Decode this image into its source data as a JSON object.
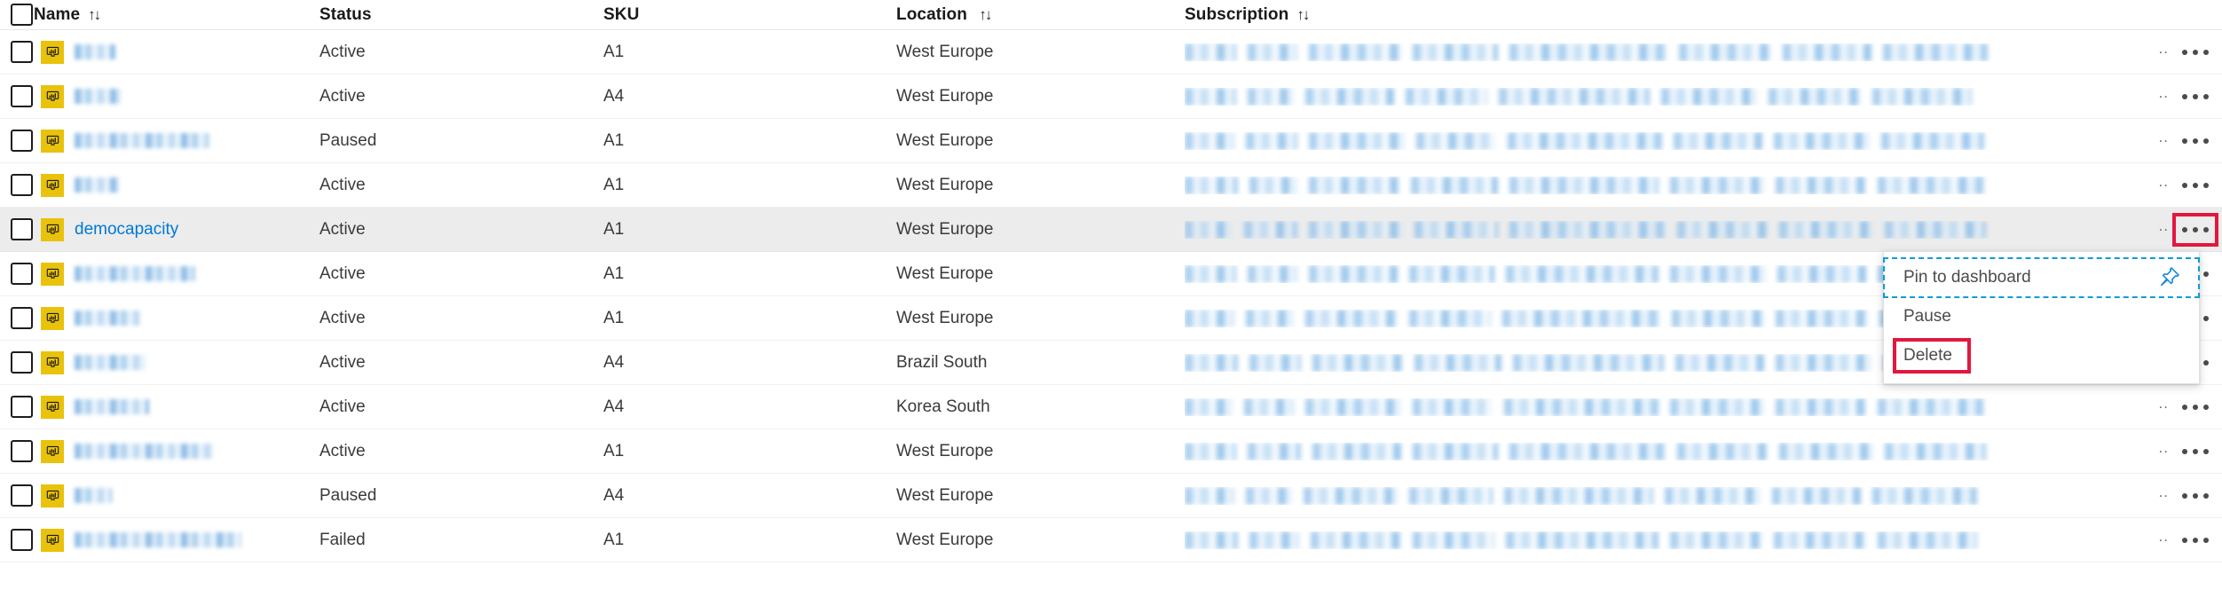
{
  "table": {
    "columns": [
      {
        "key": "name",
        "label": "Name",
        "sortable": true,
        "sort_glyph": "↑↓"
      },
      {
        "key": "status",
        "label": "Status",
        "sortable": false,
        "sort_glyph": ""
      },
      {
        "key": "sku",
        "label": "SKU",
        "sortable": false,
        "sort_glyph": ""
      },
      {
        "key": "location",
        "label": "Location",
        "sortable": true,
        "sort_glyph": "↑↓"
      },
      {
        "key": "subscription",
        "label": "Subscription",
        "sortable": true,
        "sort_glyph": "↑↓"
      }
    ],
    "select_all_checked": false,
    "row_icon": "power-bi-capacity-icon",
    "overflow_label": "…",
    "subscription_truncation": "..",
    "rows": [
      {
        "name": "",
        "redacted_name": true,
        "name_width": 46,
        "status": "Active",
        "sku": "A1",
        "location": "West Europe",
        "selected": false
      },
      {
        "name": "",
        "redacted_name": true,
        "name_width": 52,
        "status": "Active",
        "sku": "A4",
        "location": "West Europe",
        "selected": false
      },
      {
        "name": "",
        "redacted_name": true,
        "name_width": 152,
        "status": "Paused",
        "sku": "A1",
        "location": "West Europe",
        "selected": false
      },
      {
        "name": "",
        "redacted_name": true,
        "name_width": 50,
        "status": "Active",
        "sku": "A1",
        "location": "West Europe",
        "selected": false
      },
      {
        "name": "democapacity",
        "redacted_name": false,
        "name_width": 0,
        "status": "Active",
        "sku": "A1",
        "location": "West Europe",
        "selected": true
      },
      {
        "name": "",
        "redacted_name": true,
        "name_width": 136,
        "status": "Active",
        "sku": "A1",
        "location": "West Europe",
        "selected": false
      },
      {
        "name": "",
        "redacted_name": true,
        "name_width": 74,
        "status": "Active",
        "sku": "A1",
        "location": "West Europe",
        "selected": false
      },
      {
        "name": "",
        "redacted_name": true,
        "name_width": 80,
        "status": "Active",
        "sku": "A4",
        "location": "Brazil South",
        "selected": false
      },
      {
        "name": "",
        "redacted_name": true,
        "name_width": 84,
        "status": "Active",
        "sku": "A4",
        "location": "Korea South",
        "selected": false
      },
      {
        "name": "",
        "redacted_name": true,
        "name_width": 156,
        "status": "Active",
        "sku": "A1",
        "location": "West Europe",
        "selected": false
      },
      {
        "name": "",
        "redacted_name": true,
        "name_width": 42,
        "status": "Paused",
        "sku": "A4",
        "location": "West Europe",
        "selected": false
      },
      {
        "name": "",
        "redacted_name": true,
        "name_width": 188,
        "status": "Failed",
        "sku": "A1",
        "location": "West Europe",
        "selected": false
      }
    ]
  },
  "context_menu": {
    "visible": true,
    "anchor_row": "democapacity",
    "items": [
      {
        "label": "Pin to dashboard",
        "icon": "pin-icon",
        "focused": true,
        "highlighted": false
      },
      {
        "label": "Pause",
        "icon": "",
        "focused": false,
        "highlighted": false
      },
      {
        "label": "Delete",
        "icon": "",
        "focused": false,
        "highlighted": true
      }
    ]
  },
  "annotations": {
    "highlight_color": "#e3173e",
    "focus_color": "#0f9bd7",
    "accent_link_color": "#0078d4",
    "icon_background_color": "#e9c20b",
    "selected_row_color": "#ececec"
  }
}
